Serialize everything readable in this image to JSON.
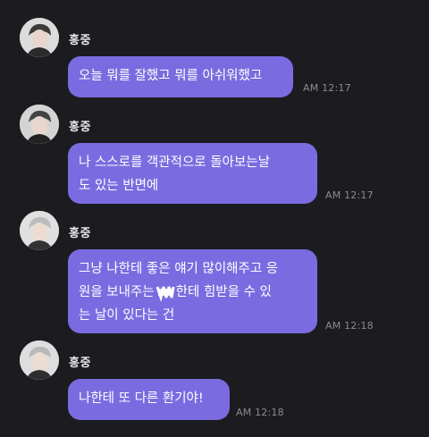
{
  "messages": [
    {
      "sender": "홍중",
      "lines": [
        "오늘 뭐를 잘했고 뭐를 아쉬워했고"
      ],
      "time": "AM 12:17"
    },
    {
      "sender": "홍중",
      "lines": [
        "나 스스로를 객관적으로 돌아보는날",
        "도 있는 반면에"
      ],
      "time": "AM 12:17"
    },
    {
      "sender": "홍중",
      "lines": [
        "그냥 나한테 좋은 얘기 많이해주고 응",
        "원을 보내주는",
        "한테 힘받을 수 있",
        "는 날이 있다는 건"
      ],
      "time": "AM 12:18"
    },
    {
      "sender": "홍중",
      "lines": [
        "나한테 또 다른 환기야!"
      ],
      "time": "AM 12:18"
    }
  ],
  "colors": {
    "background": "#1c1c20",
    "bubble": "#7a6ce0",
    "time": "#8a8a90"
  }
}
